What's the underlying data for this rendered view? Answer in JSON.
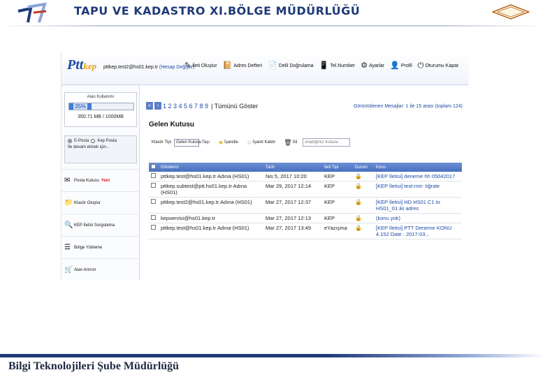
{
  "slide": {
    "title": "TAPU VE KADASTRO XI.BÖLGE MÜDÜRLÜĞÜ",
    "footer": "Bilgi Teknolojileri Şube Müdürlüğü"
  },
  "app": {
    "logo_main": "Ptt",
    "logo_sub": "kep",
    "account": "pttkep.test2@hs01.kep.tr",
    "account_change": "(Hesap Değiştir)",
    "nav": [
      {
        "icon": "pen-icon",
        "glyph": "✎",
        "label": "İleti Oluştur"
      },
      {
        "icon": "address-book-icon",
        "glyph": "📔",
        "label": "Adres Defteri"
      },
      {
        "icon": "doc-verify-icon",
        "glyph": "📄",
        "label": "Delil Doğrulama"
      },
      {
        "icon": "phone-icon",
        "glyph": "📱",
        "label": "Tel.Number"
      },
      {
        "icon": "gear-icon",
        "glyph": "⚙",
        "label": "Ayarlar"
      },
      {
        "icon": "profile-icon",
        "glyph": "👤",
        "label": "Profil"
      },
      {
        "icon": "power-icon",
        "glyph": "⏻",
        "label": "Oturumu Kapat"
      }
    ]
  },
  "sidebar": {
    "quota_label": "Alan Kullanımı",
    "quota_percent": "35%",
    "quota_fraction": 0.35,
    "quota_text": "350.71 MB / 1000MB",
    "mode_email": "E-Posta",
    "mode_kep": "Kep Posta",
    "mode_note": "İle devam etmek için...",
    "menu": [
      {
        "icon": "inbox-icon",
        "glyph": "✉",
        "label": "Posta Kutusu",
        "badge": "Yeni"
      },
      {
        "icon": "folder-icon",
        "glyph": "📁",
        "label": "Klasör Oluştur",
        "badge": ""
      },
      {
        "icon": "search-icon",
        "glyph": "🔍",
        "label": "KEP İletisi Sorgulama",
        "badge": ""
      },
      {
        "icon": "list-icon",
        "glyph": "☰",
        "label": "Bölge Yükleme",
        "badge": ""
      },
      {
        "icon": "cart-icon",
        "glyph": "🛒",
        "label": "Alan Artırım",
        "badge": ""
      }
    ]
  },
  "main": {
    "pager_pages": "1 2 3 4 5 6 7 8 9",
    "pager_all": "| Tümünü Göster",
    "pager_info": "Görüntülenen Mesajlar: 1 ile 15 arası (toplam 124)",
    "section_title": "Gelen Kutusu",
    "filter_label": "Klasör Tipi",
    "filter_value": "Gelen Kutusu",
    "filter_action": "Taşı",
    "mark_label": "İşaretle",
    "unmark_label": "İşaret Kaldır",
    "delete_label": "Sil",
    "search_placeholder": "Aradığınız Kutusu",
    "columns": [
      "Gönderici",
      "Tarih",
      "İleti Tipi",
      "Durum",
      "Konu"
    ],
    "rows": [
      {
        "sender": "pttkep.test@hs01.kep.tr Adına (HS01)",
        "date": "Nis 5, 2017 10:20",
        "type": "KEP",
        "subject": "[KEP İletisi] deneme hh 05042017"
      },
      {
        "sender": "pttkep.subtest@ptt.hs01.kep.tr Adına (HS01)",
        "date": "Mar 29, 2017 12:14",
        "type": "KEP",
        "subject": "[KEP İletisi] test-rmt- öğrale"
      },
      {
        "sender": "pttkep.test2@hs01.kep.tr Adına (HS01)",
        "date": "Mar 27, 2017 12:37",
        "type": "KEP",
        "subject": "[KEP İletisi] HD HS01 C1 to HS01_01 iki adres"
      },
      {
        "sender": "kepservisi@hs01.kep.tr",
        "date": "Mar 27, 2017 12:13",
        "type": "KEP",
        "subject": "(konu yok)"
      },
      {
        "sender": "pttkep.test@hs01.kep.tr Adına (HS01)",
        "date": "Mar 27, 2017 13:49",
        "type": "eYazışma",
        "subject": "[KEP İletisi] PTT Deneme KONU 4.152 Date : 2017-03..."
      }
    ]
  }
}
